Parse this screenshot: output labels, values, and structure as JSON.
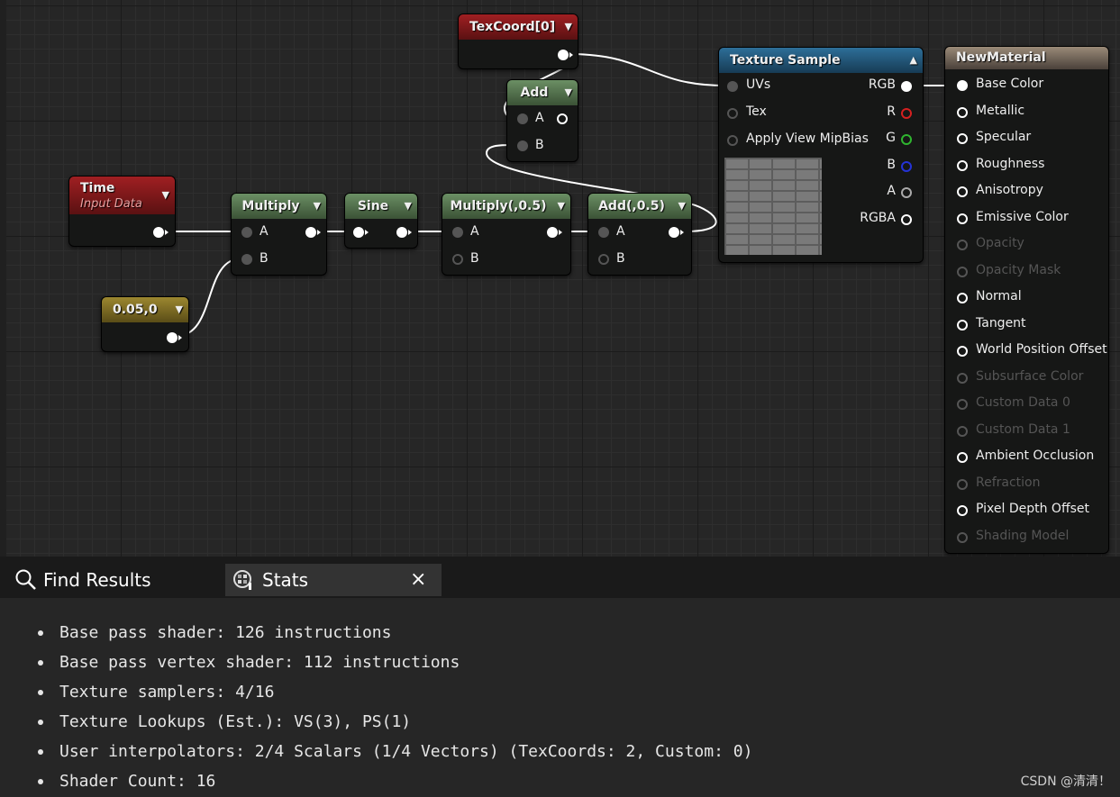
{
  "nodes": {
    "texcoord": {
      "title": "TexCoord[0]"
    },
    "add_top": {
      "title": "Add",
      "pin_a": "A",
      "pin_b": "B"
    },
    "time": {
      "title": "Time",
      "subtitle": "Input Data"
    },
    "multiply1": {
      "title": "Multiply",
      "pin_a": "A",
      "pin_b": "B"
    },
    "sine": {
      "title": "Sine"
    },
    "multiply2": {
      "title": "Multiply(,0.5)",
      "pin_a": "A",
      "pin_b": "B"
    },
    "add2": {
      "title": "Add(,0.5)",
      "pin_a": "A",
      "pin_b": "B"
    },
    "constant": {
      "title": "0.05,0"
    },
    "texture_sample": {
      "title": "Texture Sample",
      "inputs": [
        "UVs",
        "Tex",
        "Apply View MipBias"
      ],
      "outputs": [
        "RGB",
        "R",
        "G",
        "B",
        "A",
        "RGBA"
      ],
      "output_colors": [
        "#ffffff",
        "#d62020",
        "#2fb52f",
        "#2433d6",
        "#aaaaaa",
        "#ffffff"
      ]
    },
    "material": {
      "title": "NewMaterial",
      "inputs": [
        {
          "label": "Base Color",
          "enabled": true
        },
        {
          "label": "Metallic",
          "enabled": true
        },
        {
          "label": "Specular",
          "enabled": true
        },
        {
          "label": "Roughness",
          "enabled": true
        },
        {
          "label": "Anisotropy",
          "enabled": true
        },
        {
          "label": "Emissive Color",
          "enabled": true
        },
        {
          "label": "Opacity",
          "enabled": false
        },
        {
          "label": "Opacity Mask",
          "enabled": false
        },
        {
          "label": "Normal",
          "enabled": true
        },
        {
          "label": "Tangent",
          "enabled": true
        },
        {
          "label": "World Position Offset",
          "enabled": true
        },
        {
          "label": "Subsurface Color",
          "enabled": false
        },
        {
          "label": "Custom Data 0",
          "enabled": false
        },
        {
          "label": "Custom Data 1",
          "enabled": false
        },
        {
          "label": "Ambient Occlusion",
          "enabled": true
        },
        {
          "label": "Refraction",
          "enabled": false
        },
        {
          "label": "Pixel Depth Offset",
          "enabled": true
        },
        {
          "label": "Shading Model",
          "enabled": false
        }
      ]
    }
  },
  "tabs": {
    "find_results": "Find Results",
    "stats": "Stats",
    "close": "×"
  },
  "stats": [
    "Base pass shader: 126 instructions",
    "Base pass vertex shader: 112 instructions",
    "Texture samplers: 4/16",
    "Texture Lookups (Est.): VS(3), PS(1)",
    "User interpolators: 2/4 Scalars (1/4 Vectors) (TexCoords: 2, Custom: 0)",
    "Shader Count: 16"
  ],
  "watermark": "CSDN @清清！"
}
